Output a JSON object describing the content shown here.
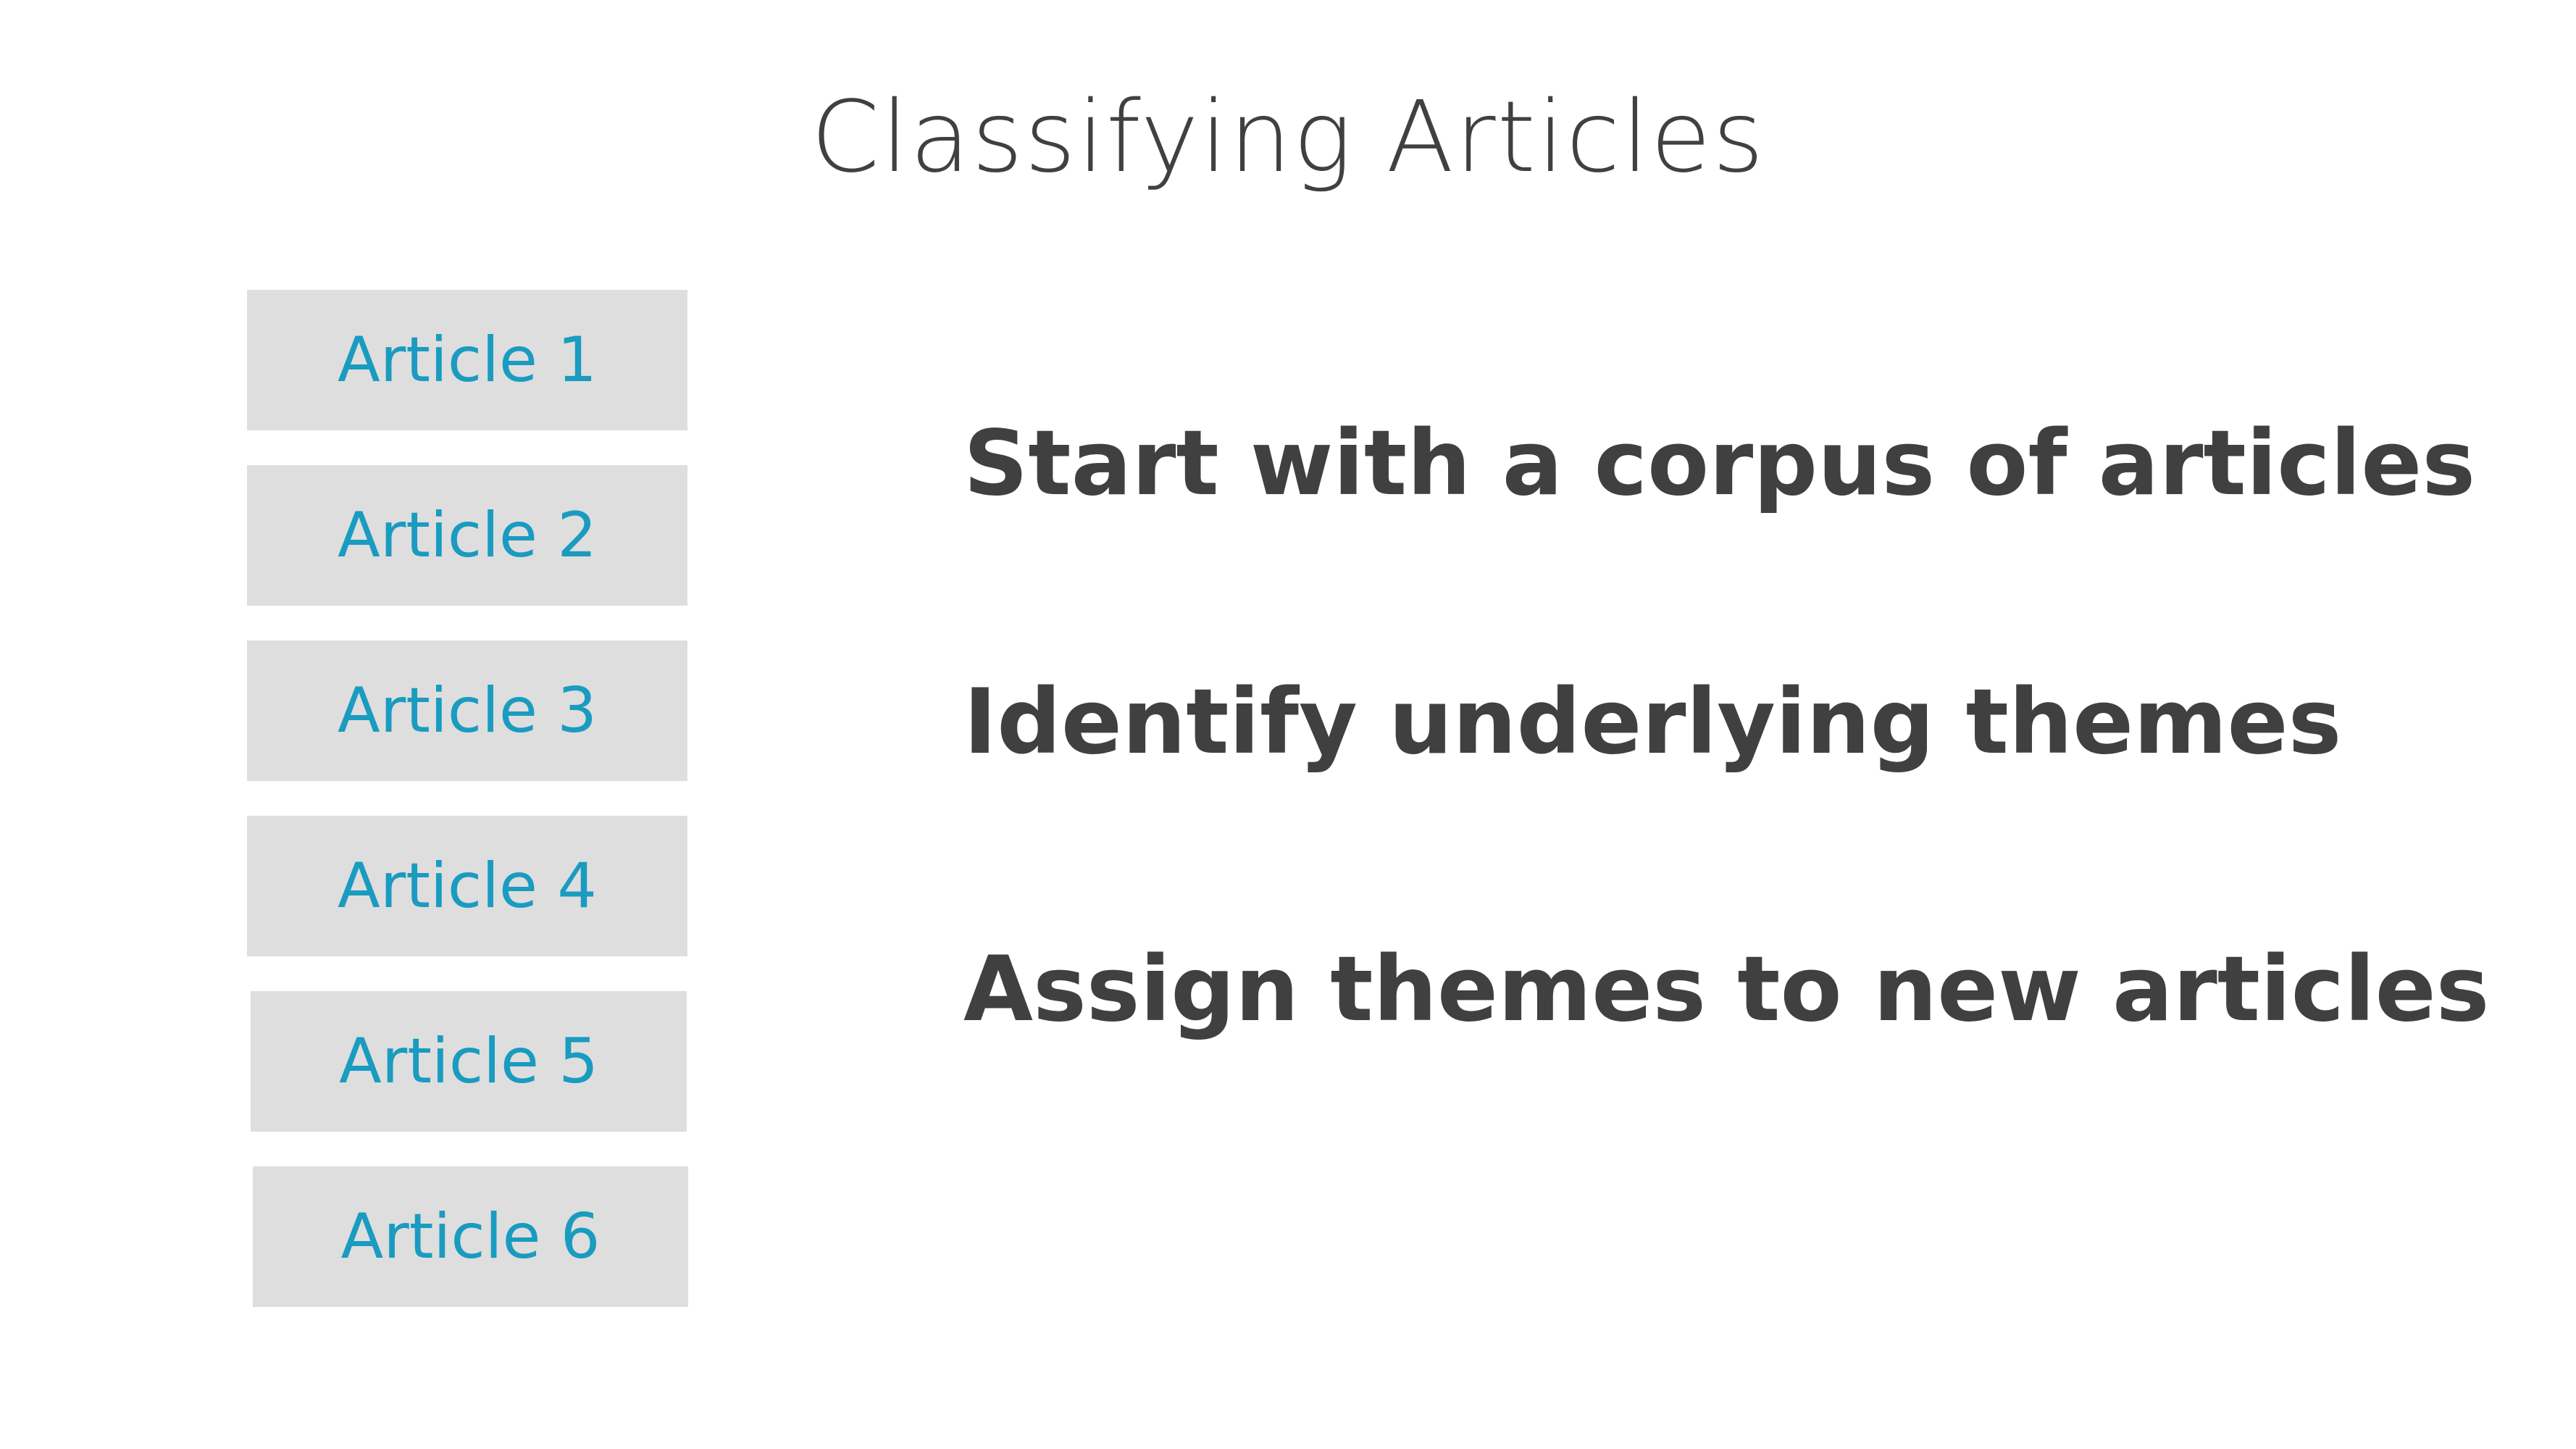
{
  "title": "Classifying Articles",
  "articles": [
    {
      "label": "Article 1"
    },
    {
      "label": "Article 2"
    },
    {
      "label": "Article 3"
    },
    {
      "label": "Article 4"
    },
    {
      "label": "Article 5"
    },
    {
      "label": "Article 6"
    }
  ],
  "bullets": [
    "Start with a corpus of articles",
    "Identify underlying themes",
    "Assign themes to new articles"
  ],
  "colors": {
    "article_text": "#1a9bc0",
    "article_box": "#dedede",
    "body_text": "#404040"
  }
}
